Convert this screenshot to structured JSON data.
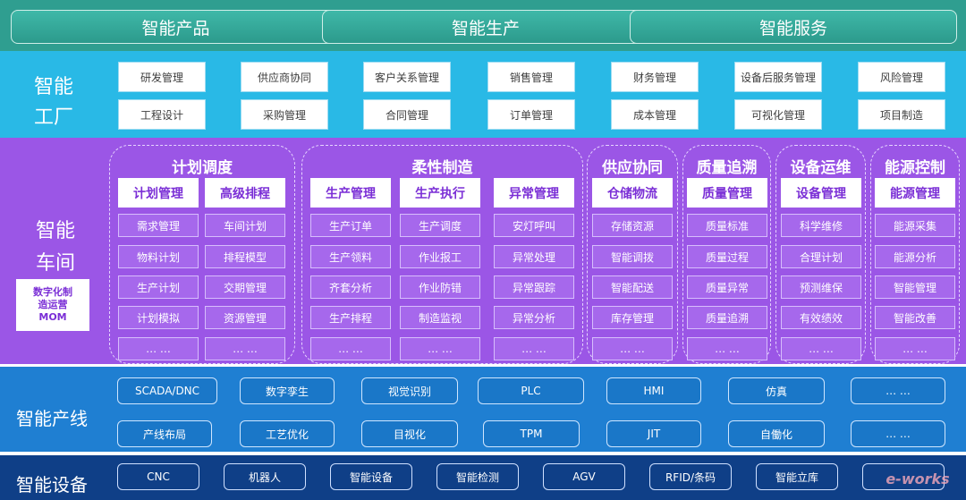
{
  "top": {
    "items": [
      "智能产品",
      "智能生产",
      "智能服务"
    ]
  },
  "factory": {
    "title_line1": "智能",
    "title_line2": "工厂",
    "row1": [
      "研发管理",
      "供应商协同",
      "客户关系管理",
      "销售管理",
      "财务管理",
      "设备后服务管理",
      "风险管理"
    ],
    "row2": [
      "工程设计",
      "采购管理",
      "合同管理",
      "订单管理",
      "成本管理",
      "可视化管理",
      "项目制造"
    ]
  },
  "workshop": {
    "title_line1": "智能",
    "title_line2": "车间",
    "mom_line1": "数字化制",
    "mom_line2": "造运营",
    "mom_line3": "MOM",
    "groups": [
      {
        "title": "计划调度",
        "columns": [
          {
            "head": "计划管理",
            "cells": [
              "需求管理",
              "物料计划",
              "生产计划",
              "计划模拟",
              "… …"
            ]
          },
          {
            "head": "高级排程",
            "cells": [
              "车间计划",
              "排程模型",
              "交期管理",
              "资源管理",
              "… …"
            ]
          }
        ]
      },
      {
        "title": "柔性制造",
        "columns": [
          {
            "head": "生产管理",
            "cells": [
              "生产订单",
              "生产领料",
              "齐套分析",
              "生产排程",
              "… …"
            ]
          },
          {
            "head": "生产执行",
            "cells": [
              "生产调度",
              "作业报工",
              "作业防错",
              "制造监视",
              "… …"
            ]
          },
          {
            "head": "异常管理",
            "cells": [
              "安灯呼叫",
              "异常处理",
              "异常跟踪",
              "异常分析",
              "… …"
            ]
          }
        ]
      },
      {
        "title": "供应协同",
        "columns": [
          {
            "head": "仓储物流",
            "cells": [
              "存储资源",
              "智能调拨",
              "智能配送",
              "库存管理",
              "… …"
            ]
          }
        ]
      },
      {
        "title": "质量追溯",
        "columns": [
          {
            "head": "质量管理",
            "cells": [
              "质量标准",
              "质量过程",
              "质量异常",
              "质量追溯",
              "… …"
            ]
          }
        ]
      },
      {
        "title": "设备运维",
        "columns": [
          {
            "head": "设备管理",
            "cells": [
              "科学维修",
              "合理计划",
              "预测维保",
              "有效绩效",
              "… …"
            ]
          }
        ]
      },
      {
        "title": "能源控制",
        "columns": [
          {
            "head": "能源管理",
            "cells": [
              "能源采集",
              "能源分析",
              "智能管理",
              "智能改善",
              "… …"
            ]
          }
        ]
      }
    ]
  },
  "line": {
    "title": "智能产线",
    "row1": [
      "SCADA/DNC",
      "数字孪生",
      "视觉识别",
      "PLC",
      "HMI",
      "仿真",
      "… …"
    ],
    "row2": [
      "产线布局",
      "工艺优化",
      "目视化",
      "TPM",
      "JIT",
      "自働化",
      "… …"
    ]
  },
  "device": {
    "title": "智能设备",
    "items": [
      "CNC",
      "机器人",
      "智能设备",
      "智能检测",
      "AGV",
      "RFID/条码",
      "智能立库",
      ""
    ]
  },
  "watermark": "e-works",
  "colors": {
    "top": "#2f9e90",
    "factory": "#29b9e6",
    "workshop": "#9b56e6",
    "line": "#1f7fd2",
    "device": "#0f3f87"
  }
}
